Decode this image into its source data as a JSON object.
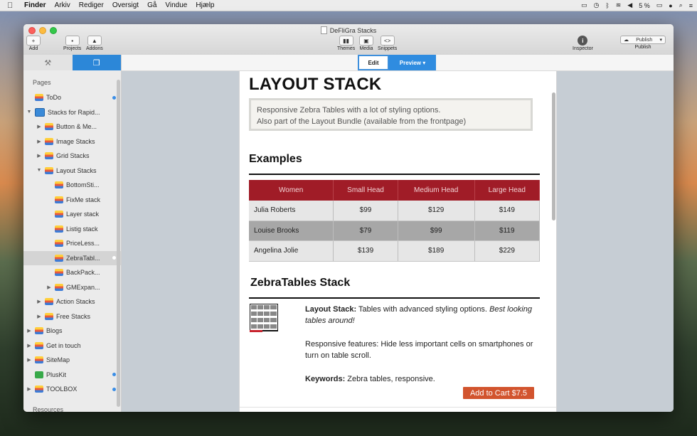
{
  "menubar": {
    "items": [
      "Finder",
      "Arkiv",
      "Rediger",
      "Oversigt",
      "Gå",
      "Vindue",
      "Hjælp"
    ],
    "battery": "5 %"
  },
  "window": {
    "title": "DeFliGra Stacks",
    "toolbar": {
      "add": "Add",
      "projects": "Projects",
      "addons": "Addons",
      "themes": "Themes",
      "media": "Media",
      "snippets": "Snippets",
      "inspector": "Inspector",
      "publish_button": "Publish",
      "publish": "Publish"
    }
  },
  "sidebar": {
    "pages_heading": "Pages",
    "resources_heading": "Resources",
    "items": [
      {
        "label": "ToDo",
        "level": 0,
        "arrow": "",
        "icon": "stack",
        "dot": "blue"
      },
      {
        "label": "Stacks for Rapid...",
        "level": 0,
        "arrow": "down",
        "icon": "rw",
        "dot": ""
      },
      {
        "label": "Button & Me...",
        "level": 1,
        "arrow": "right",
        "icon": "stack",
        "dot": ""
      },
      {
        "label": "Image Stacks",
        "level": 1,
        "arrow": "right",
        "icon": "stack",
        "dot": ""
      },
      {
        "label": "Grid Stacks",
        "level": 1,
        "arrow": "right",
        "icon": "stack",
        "dot": ""
      },
      {
        "label": "Layout Stacks",
        "level": 1,
        "arrow": "down",
        "icon": "stack",
        "dot": ""
      },
      {
        "label": "BottomSti...",
        "level": 2,
        "arrow": "",
        "icon": "stack",
        "dot": ""
      },
      {
        "label": "FixMe stack",
        "level": 2,
        "arrow": "",
        "icon": "stack",
        "dot": ""
      },
      {
        "label": "Layer stack",
        "level": 2,
        "arrow": "",
        "icon": "stack",
        "dot": ""
      },
      {
        "label": "Listig stack",
        "level": 2,
        "arrow": "",
        "icon": "stack",
        "dot": ""
      },
      {
        "label": "PriceLess...",
        "level": 2,
        "arrow": "",
        "icon": "stack",
        "dot": ""
      },
      {
        "label": "ZebraTabl...",
        "level": 2,
        "arrow": "",
        "icon": "stack",
        "dot": "white",
        "selected": true
      },
      {
        "label": "BackPack...",
        "level": 2,
        "arrow": "",
        "icon": "stack",
        "dot": ""
      },
      {
        "label": "GMExpan...",
        "level": 2,
        "arrow": "right",
        "icon": "stack",
        "dot": ""
      },
      {
        "label": "Action Stacks",
        "level": 1,
        "arrow": "right",
        "icon": "stack",
        "dot": ""
      },
      {
        "label": "Free Stacks",
        "level": 1,
        "arrow": "right",
        "icon": "stack",
        "dot": ""
      },
      {
        "label": "Blogs",
        "level": 0,
        "arrow": "right",
        "icon": "stack",
        "dot": ""
      },
      {
        "label": "Get in touch",
        "level": 0,
        "arrow": "right",
        "icon": "stack",
        "dot": ""
      },
      {
        "label": "SiteMap",
        "level": 0,
        "arrow": "right",
        "icon": "stack",
        "dot": ""
      },
      {
        "label": "PlusKit",
        "level": 0,
        "arrow": "",
        "icon": "plus",
        "dot": "blue"
      },
      {
        "label": "TOOLBOX",
        "level": 0,
        "arrow": "right",
        "icon": "stack",
        "dot": "blue"
      }
    ]
  },
  "topbar": {
    "edit": "Edit",
    "preview": "Preview"
  },
  "content": {
    "title": "LAYOUT STACK",
    "intro_line1": "Responsive Zebra Tables with a lot of styling options.",
    "intro_line2": "Also part of the Layout Bundle (available from the frontpage)",
    "examples_heading": "Examples",
    "table": {
      "headers": [
        "Women",
        "Small Head",
        "Medium Head",
        "Large Head"
      ],
      "rows": [
        [
          "Julia Roberts",
          "$99",
          "$129",
          "$149"
        ],
        [
          "Louise Brooks",
          "$79",
          "$99",
          "$119"
        ],
        [
          "Angelina Jolie",
          "$139",
          "$189",
          "$229"
        ]
      ]
    },
    "zebra_heading": "ZebraTables Stack",
    "desc": {
      "layout_label": "Layout Stack:",
      "layout_text": " Tables with advanced styling options. ",
      "layout_italic": "Best looking tables around!",
      "responsive": "Responsive features: Hide less important cells on smartphones or turn on table scroll.",
      "keywords_label": "Keywords:",
      "keywords_text": " Zebra tables, responsive."
    },
    "cart_button": "Add to Cart $7.5"
  }
}
